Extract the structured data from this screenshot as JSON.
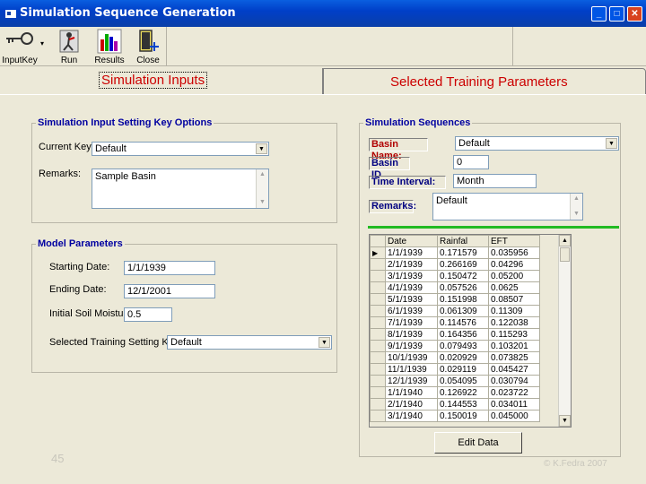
{
  "window": {
    "title": "Simulation Sequence Generation"
  },
  "toolbar": {
    "inputkey_label": "InputKey",
    "run_label": "Run",
    "results_label": "Results",
    "close_label": "Close"
  },
  "tabs": {
    "tab1": "Simulation Inputs",
    "tab2": "Selected Training Parameters"
  },
  "key_options": {
    "legend": "Simulation Input Setting Key Options",
    "current_key_label": "Current Key:",
    "current_key_value": "Default",
    "remarks_label": "Remarks:",
    "remarks_value": "Sample Basin"
  },
  "model_params": {
    "legend": "Model Parameters",
    "start_label": "Starting Date:",
    "start_value": "1/1/1939",
    "end_label": "Ending Date:",
    "end_value": "12/1/2001",
    "soil_label": "Initial Soil Moisture:",
    "soil_value": "0.5",
    "training_label": "Selected Training Setting Key:",
    "training_value": "Default"
  },
  "sequences": {
    "legend": "Simulation Sequences",
    "basin_name_label": "Basin Name:",
    "basin_name_value": "Default",
    "basin_id_label": "Basin ID",
    "basin_id_value": "0",
    "time_interval_label": "Time Interval:",
    "time_interval_value": "Month",
    "remarks_label": "Remarks:",
    "remarks_value": "Default",
    "columns": [
      "Date",
      "Rainfal",
      "EFT"
    ],
    "rows": [
      [
        "1/1/1939",
        "0.171579",
        "0.035956"
      ],
      [
        "2/1/1939",
        "0.266169",
        "0.04296"
      ],
      [
        "3/1/1939",
        "0.150472",
        "0.05200"
      ],
      [
        "4/1/1939",
        "0.057526",
        "0.0625"
      ],
      [
        "5/1/1939",
        "0.151998",
        "0.08507"
      ],
      [
        "6/1/1939",
        "0.061309",
        "0.11309"
      ],
      [
        "7/1/1939",
        "0.114576",
        "0.122038"
      ],
      [
        "8/1/1939",
        "0.164356",
        "0.115293"
      ],
      [
        "9/1/1939",
        "0.079493",
        "0.103201"
      ],
      [
        "10/1/1939",
        "0.020929",
        "0.073825"
      ],
      [
        "11/1/1939",
        "0.029119",
        "0.045427"
      ],
      [
        "12/1/1939",
        "0.054095",
        "0.030794"
      ],
      [
        "1/1/1940",
        "0.126922",
        "0.023722"
      ],
      [
        "2/1/1940",
        "0.144553",
        "0.034011"
      ],
      [
        "3/1/1940",
        "0.150019",
        "0.045000"
      ]
    ],
    "edit_button": "Edit Data"
  },
  "footer": {
    "slide_number": "45",
    "copyright": "© K.Fedra 2007"
  }
}
